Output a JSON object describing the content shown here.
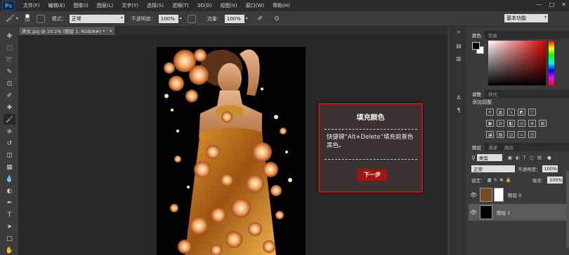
{
  "menubar": {
    "logo": "Ps",
    "items": [
      "文件(F)",
      "编辑(E)",
      "图像(I)",
      "图层(L)",
      "文字(Y)",
      "选择(S)",
      "滤镜(T)",
      "3D(D)",
      "视图(V)",
      "窗口(W)",
      "帮助(H)"
    ],
    "window_buttons": [
      "—",
      "□",
      "✕"
    ]
  },
  "options": {
    "brush_size": "50",
    "mode_label": "模式：",
    "mode_value": "正常",
    "opacity_label": "不透明度：",
    "opacity_value": "100%",
    "flow_label": "流量：",
    "flow_value": "100%",
    "workspace": "基本功能"
  },
  "document": {
    "tab_title": "美女.jpg @ 10.1% (图层 1, RGB/8#) *",
    "close": "×"
  },
  "tools": [
    "move-tool",
    "marquee-tool",
    "lasso-tool",
    "quick-selection-tool",
    "crop-tool",
    "eyedropper-tool",
    "healing-brush-tool",
    "brush-tool",
    "clone-stamp-tool",
    "history-brush-tool",
    "eraser-tool",
    "gradient-tool",
    "blur-tool",
    "dodge-tool",
    "pen-tool",
    "type-tool",
    "path-selection-tool",
    "rectangle-tool",
    "hand-tool"
  ],
  "tool_glyphs": [
    "✥",
    "⬚",
    "➰",
    "✎",
    "⊡",
    "✐",
    "✚",
    "🖌",
    "⎈",
    "↺",
    "◫",
    "▦",
    "💧",
    "◐",
    "✒",
    "T",
    "➤",
    "□",
    "✋"
  ],
  "dialog": {
    "title": "填充颜色",
    "body": "快捷键“Alt+Delete”填充前景色黑色。",
    "button": "下一步",
    "accent": "#b51a12"
  },
  "panels": {
    "color_tabs": [
      "颜色",
      "色板"
    ],
    "adjust_tabs": [
      "调整",
      "样式"
    ],
    "adjust_label": "添加调整",
    "layer_tabs": [
      "图层",
      "通道",
      "路径"
    ],
    "kind_label": "类型",
    "blend_mode": "正常",
    "opacity_label": "不透明度：",
    "opacity_value": "100%",
    "lock_label": "锁定：",
    "fill_label": "填充：",
    "fill_value": "100%",
    "layers": [
      {
        "name": "图层 0",
        "selected": false
      },
      {
        "name": "图层 1",
        "selected": true
      }
    ]
  }
}
